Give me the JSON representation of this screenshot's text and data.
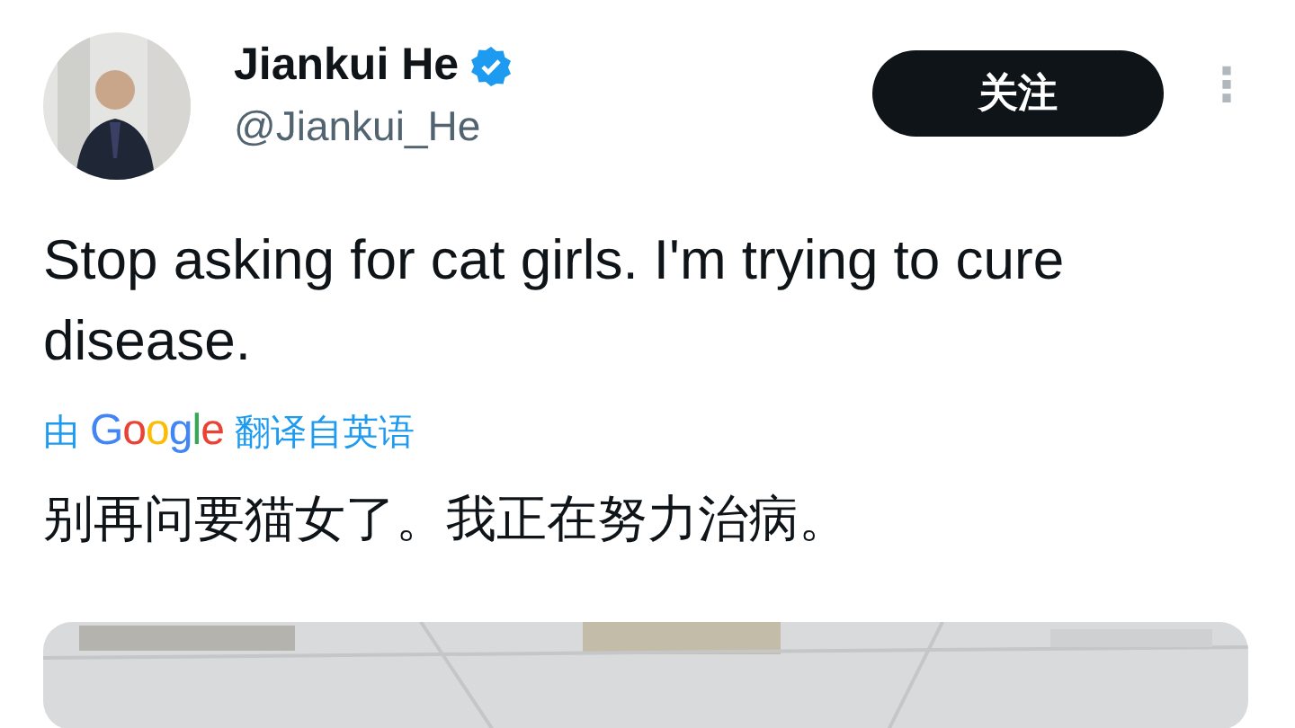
{
  "author": {
    "name": "Jiankui He",
    "verified": true,
    "handle": "@Jiankui_He"
  },
  "follow_button": "关注",
  "more_menu": "⋮",
  "tweet": {
    "text": "Stop asking for cat girls. I'm trying to cure disease.",
    "translation_note": {
      "prefix": "由",
      "provider": "Google",
      "suffix": "翻译自英语"
    },
    "translated_text": "别再问要猫女了。我正在努力治病。"
  }
}
